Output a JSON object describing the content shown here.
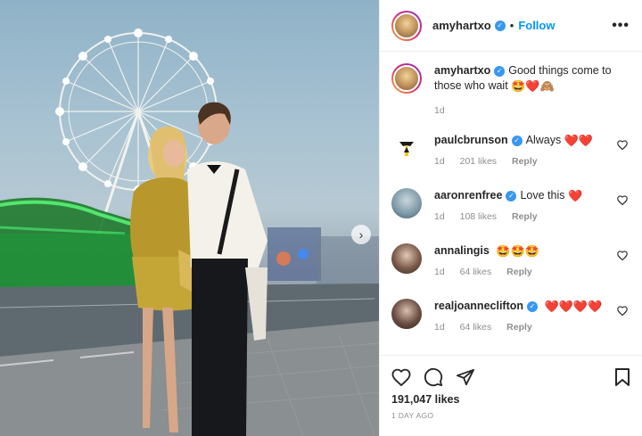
{
  "post": {
    "author": "amyhartxo",
    "follow_label": "Follow",
    "dot": "•",
    "more_label": "•••",
    "caption_text": "Good things come to those who wait",
    "caption_emojis": "🤩❤️🙈",
    "caption_time": "1d",
    "likes": "191,047 likes",
    "posted": "1 DAY AGO",
    "next_arrow": "›"
  },
  "comments": [
    {
      "username": "paulcbrunson",
      "text": "Always",
      "emojis": "❤️❤️",
      "time": "1d",
      "likes": "201 likes",
      "reply": "Reply"
    },
    {
      "username": "aaronrenfree",
      "text": "Love this",
      "emojis": "❤️",
      "time": "1d",
      "likes": "108 likes",
      "reply": "Reply"
    },
    {
      "username": "annalingis",
      "text": "",
      "emojis": "🤩🤩🤩",
      "time": "1d",
      "likes": "64 likes",
      "reply": "Reply"
    },
    {
      "username": "realjoanneclifton",
      "text": "",
      "emojis": "❤️❤️❤️❤️",
      "time": "1d",
      "likes": "64 likes",
      "reply": "Reply"
    }
  ],
  "icons": {
    "verified": "verified-badge",
    "like": "heart-outline",
    "comment": "speech-bubble",
    "share": "paper-plane",
    "save": "bookmark",
    "carousel": "chevron-right"
  },
  "colors": {
    "link_blue": "#0095f6",
    "verified_blue": "#3897f0",
    "secondary_text": "#8e8e8e",
    "heart_red": "#ed4956"
  }
}
